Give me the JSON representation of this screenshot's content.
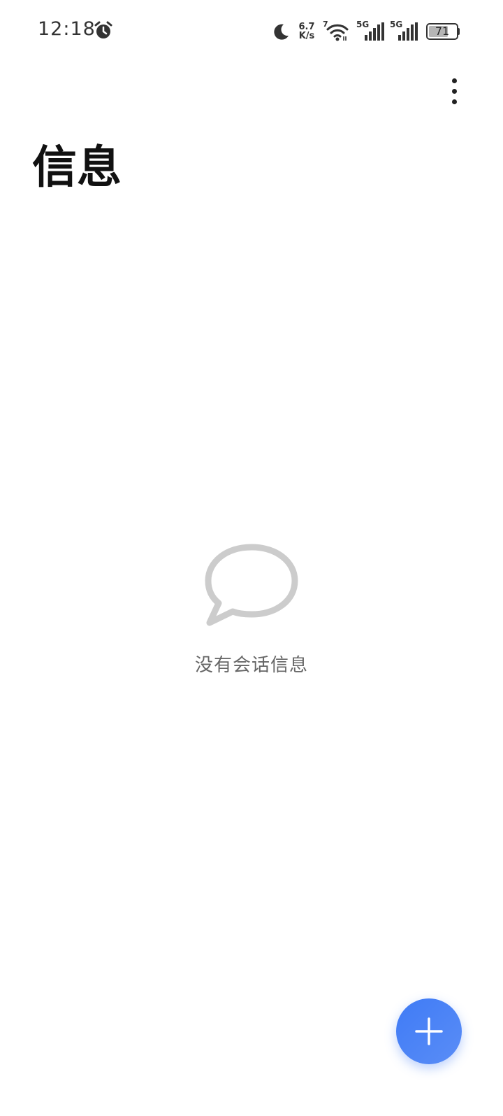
{
  "status_bar": {
    "time": "12:18",
    "net_speed_value": "6.7",
    "net_speed_unit": "K/s",
    "wifi_badge": "7",
    "signal_1_label": "5G",
    "signal_2_label": "5G",
    "battery_level": "71",
    "battery_fraction": 0.71,
    "icons": [
      "alarm-icon",
      "moon-icon",
      "wifi-icon",
      "signal-icon",
      "battery-icon"
    ]
  },
  "header": {
    "title": "信息",
    "more_icon": "more-vertical-icon"
  },
  "empty_state": {
    "icon": "chat-bubble-icon",
    "message": "没有会话信息"
  },
  "fab": {
    "icon": "plus-icon",
    "color": "#3f7bf5"
  },
  "colors": {
    "background": "#ffffff",
    "title": "#111111",
    "empty_icon": "#cccccc",
    "empty_text": "#666666",
    "accent": "#3f7bf5"
  }
}
